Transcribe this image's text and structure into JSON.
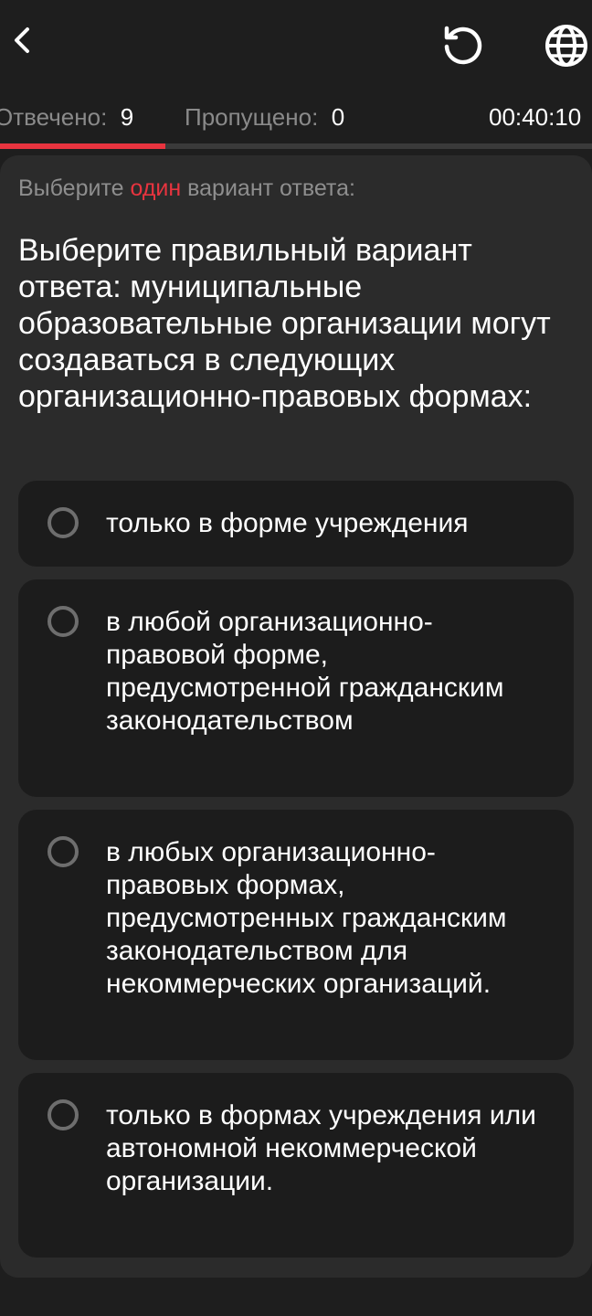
{
  "header": {
    "back_icon": "chevron-left-icon",
    "reset_icon": "reload-icon",
    "language_icon": "globe-icon"
  },
  "stats": {
    "answered_label": "Отвечено:",
    "answered_value": "9",
    "skipped_label": "Пропущено:",
    "skipped_value": "0",
    "timer": "00:40:10",
    "progress_fraction": 0.28
  },
  "quiz": {
    "instruction_prefix": "Выберите ",
    "instruction_accent": "один",
    "instruction_suffix": " вариант ответа:",
    "question": "Выберите правильный вариант ответа: муниципальные образовательные организации могут создаваться в следующих организационно-правовых формах:",
    "options": [
      {
        "text": "только в форме учреждения"
      },
      {
        "text": "в любой организационно-правовой форме, предусмотренной гражданским законодательством"
      },
      {
        "text": "в любых организационно-правовых формах, предусмотренных гражданским законодательством для некоммерческих организаций."
      },
      {
        "text": "только в формах учреждения или автономной некоммерческой организации."
      }
    ]
  },
  "colors": {
    "accent": "#e8343f",
    "background": "#1e1e1e",
    "card": "#2b2b2b",
    "option": "#1c1c1c"
  }
}
